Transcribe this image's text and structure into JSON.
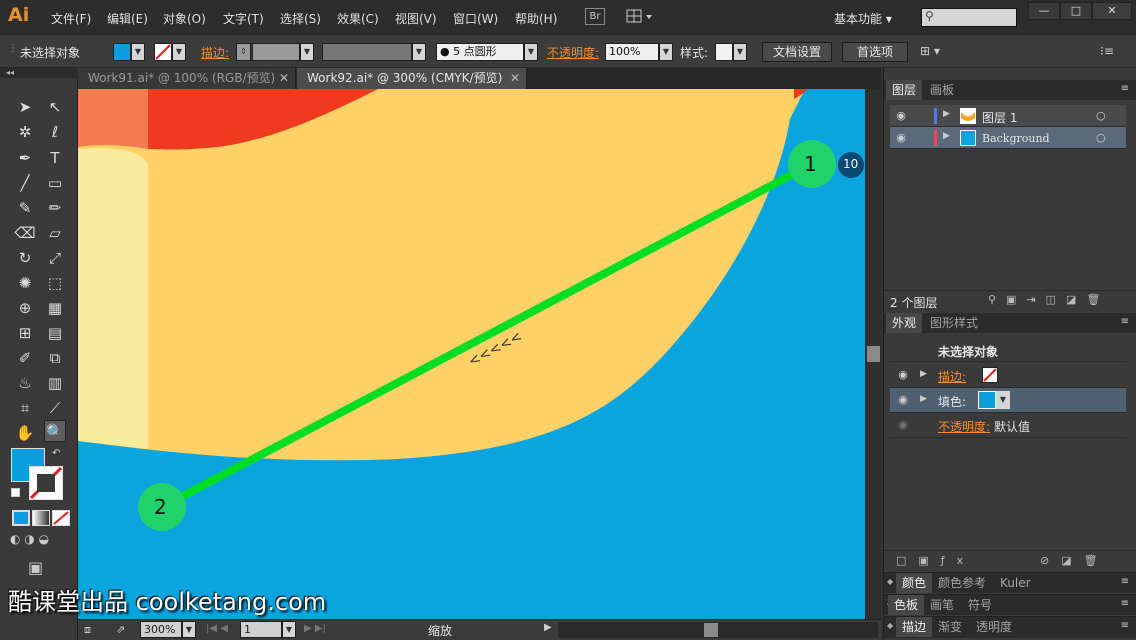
{
  "app": {
    "logo": "Ai"
  },
  "menu": [
    "文件(F)",
    "编辑(E)",
    "对象(O)",
    "文字(T)",
    "选择(S)",
    "效果(C)",
    "视图(V)",
    "窗口(W)",
    "帮助(H)"
  ],
  "bridge_label": "Br",
  "workspace_label": "基本功能",
  "window_buttons": [
    "—",
    "□",
    "✕"
  ],
  "control": {
    "selection_status": "未选择对象",
    "stroke_label": "描边:",
    "brush_value": "5 点圆形",
    "opacity_label": "不透明度:",
    "opacity_value": "100%",
    "style_label": "样式:",
    "doc_setup": "文档设置",
    "preferences": "首选项"
  },
  "tabs": [
    {
      "label": "Work91.ai* @ 100% (RGB/预览)",
      "close": "✕",
      "active": false
    },
    {
      "label": "Work92.ai* @ 300% (CMYK/预览)",
      "close": "✕",
      "active": true
    }
  ],
  "layers_panel": {
    "tabs": [
      "图层",
      "画板"
    ],
    "layers": [
      {
        "name": "图层 1",
        "color": "#4f7de0"
      },
      {
        "name": "Background",
        "color": "#e04f4f"
      }
    ],
    "count": "2 个图层"
  },
  "appearance_panel": {
    "tabs": [
      "外观",
      "图形样式"
    ],
    "header": "未选择对象",
    "stroke_label": "描边:",
    "fill_label": "填色:",
    "opacity_label": "不透明度:",
    "opacity_value": "默认值"
  },
  "bottom_panels": [
    [
      "颜色",
      "颜色参考",
      "Kuler"
    ],
    [
      "色板",
      "画笔",
      "符号"
    ],
    [
      "描边",
      "渐变",
      "透明度"
    ]
  ],
  "status": {
    "zoom": "300%",
    "page": "1",
    "tool": "缩放"
  },
  "annotation": {
    "point1": "1",
    "point2": "2",
    "badge": "10"
  },
  "watermark": {
    "cn": "酷课堂出品",
    "url": "coolketang.com"
  },
  "colors": {
    "fill": "#0a9de0",
    "canvas_bg": "#0aa4df",
    "yellow": "#ffd166",
    "red": "#f03a20",
    "green": "#00dd22",
    "marker": "#1fd36a"
  }
}
